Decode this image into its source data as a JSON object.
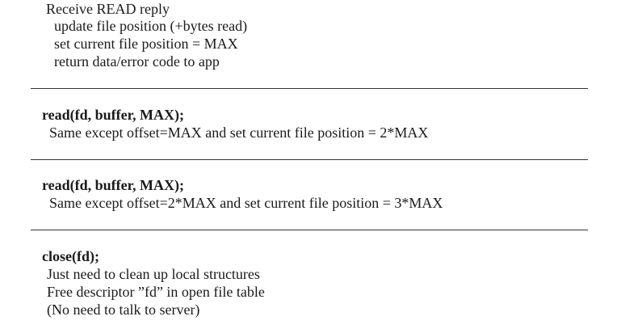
{
  "reply_section": {
    "heading": "Receive READ reply",
    "lines": [
      "update file position (+bytes read)",
      "set current file position = MAX",
      "return data/error code to app"
    ]
  },
  "read_section_1": {
    "call": "read(fd, buffer, MAX);",
    "description": "Same except offset=MAX and set current file position = 2*MAX"
  },
  "read_section_2": {
    "call": "read(fd, buffer, MAX);",
    "description": "Same except offset=2*MAX and set current file position = 3*MAX"
  },
  "close_section": {
    "call": "close(fd);",
    "lines": [
      "Just need to clean up local structures",
      "Free descriptor ”fd” in open file table",
      "(No need to talk to server)"
    ]
  }
}
